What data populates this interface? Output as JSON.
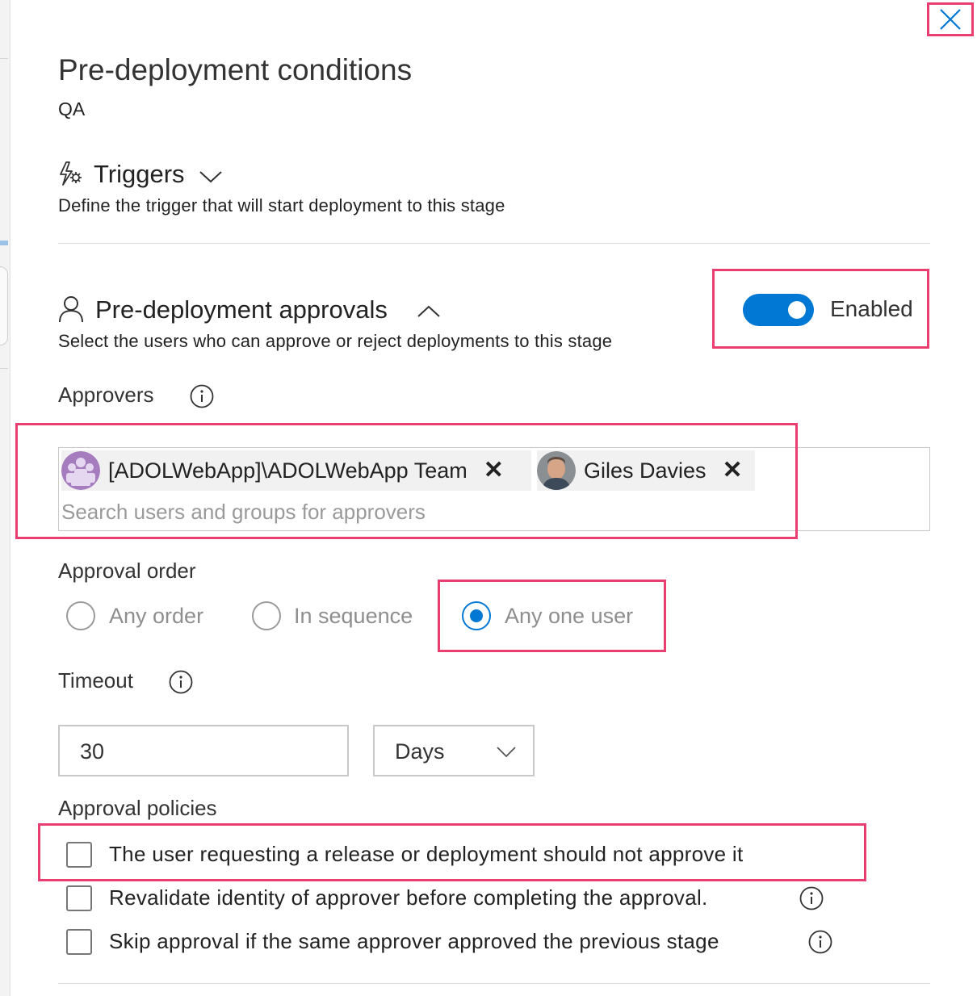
{
  "header": {
    "title": "Pre-deployment conditions",
    "stage": "QA",
    "close_icon": "close-icon"
  },
  "triggers": {
    "icon": "trigger-settings-icon",
    "title": "Triggers",
    "chevron": "chevron-down-icon",
    "description": "Define the trigger that will start deployment to this stage"
  },
  "approvals": {
    "icon": "person-icon",
    "title": "Pre-deployment approvals",
    "chevron": "chevron-up-icon",
    "description": "Select the users who can approve or reject deployments to this stage",
    "toggle_label": "Enabled",
    "toggle_on": true,
    "accent_color": "#0078d4",
    "highlight_color": "#e83e70"
  },
  "approvers": {
    "label": "Approvers",
    "chips": [
      {
        "name": "[ADOLWebApp]\\ADOLWebApp Team",
        "avatar": "group-avatar-icon",
        "remove": "✕"
      },
      {
        "name": "Giles Davies",
        "avatar": "user-photo-avatar",
        "remove": "✕"
      }
    ],
    "search_placeholder": "Search users and groups for approvers"
  },
  "approval_order": {
    "label": "Approval order",
    "options": [
      "Any order",
      "In sequence",
      "Any one user"
    ],
    "selected": "Any one user"
  },
  "timeout": {
    "label": "Timeout",
    "value": "30",
    "unit": "Days"
  },
  "policies": {
    "label": "Approval policies",
    "items": [
      {
        "label": "The user requesting a release or deployment should not approve it",
        "checked": false
      },
      {
        "label": "Revalidate identity of approver before completing the approval.",
        "checked": false
      },
      {
        "label": "Skip approval if the same approver approved the previous stage",
        "checked": false
      }
    ]
  }
}
